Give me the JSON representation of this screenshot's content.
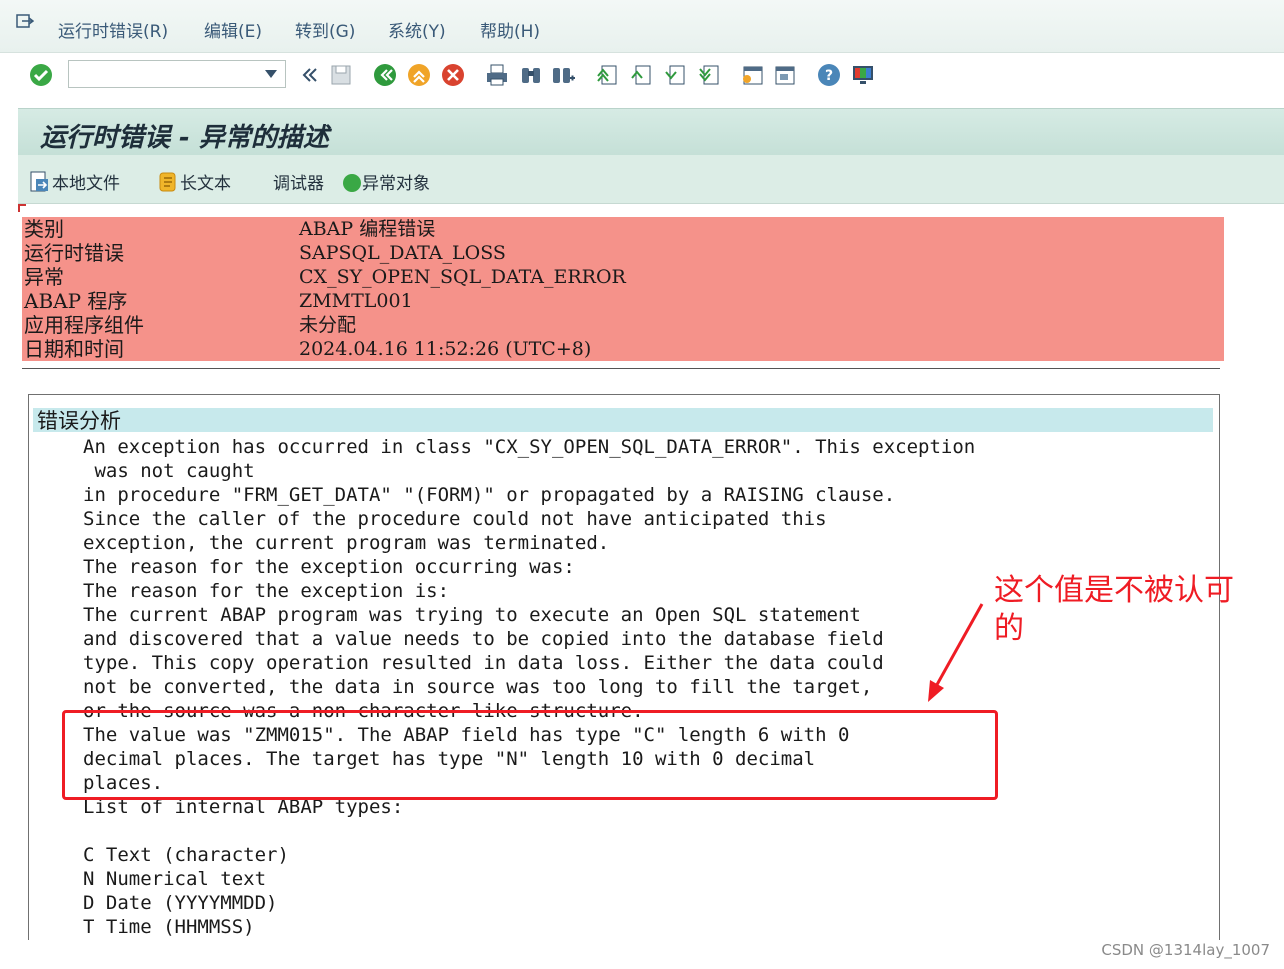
{
  "menu": {
    "items": [
      {
        "label": "运行时错误(R)"
      },
      {
        "label": "编辑(E)"
      },
      {
        "label": "转到(G)"
      },
      {
        "label": "系统(Y)"
      },
      {
        "label": "帮助(H)"
      }
    ]
  },
  "toolbar": {
    "command_field_value": "",
    "icons": [
      "enter-icon",
      "back-arrows-icon",
      "save-icon",
      "back-icon",
      "exit-icon",
      "cancel-icon",
      "print-icon",
      "find-icon",
      "find-next-icon",
      "first-page-icon",
      "previous-page-icon",
      "next-page-icon",
      "last-page-icon",
      "new-session-icon",
      "create-shortcut-icon",
      "help-icon",
      "layout-icon"
    ]
  },
  "title": "运行时错误 - 异常的描述",
  "app_toolbar": {
    "local_file": "本地文件",
    "long_text": "长文本",
    "debugger": "调试器",
    "exception_object": "异常对象"
  },
  "info": [
    {
      "label": "类别",
      "value": "ABAP 编程错误"
    },
    {
      "label": "运行时错误",
      "value": "SAPSQL_DATA_LOSS"
    },
    {
      "label": "异常",
      "value": "CX_SY_OPEN_SQL_DATA_ERROR"
    },
    {
      "label": "ABAP 程序",
      "value": "ZMMTL001"
    },
    {
      "label": "应用程序组件",
      "value": "未分配"
    },
    {
      "label": "日期和时间",
      "value": "2024.04.16 11:52:26 (UTC+8)"
    }
  ],
  "analysis": {
    "title": "错误分析",
    "lines": [
      "An exception has occurred in class \"CX_SY_OPEN_SQL_DATA_ERROR\". This exception",
      " was not caught",
      "in procedure \"FRM_GET_DATA\" \"(FORM)\" or propagated by a RAISING clause.",
      "Since the caller of the procedure could not have anticipated this",
      "exception, the current program was terminated.",
      "The reason for the exception occurring was:",
      "The reason for the exception is:",
      "The current ABAP program was trying to execute an Open SQL statement",
      "and discovered that a value needs to be copied into the database field",
      "type. This copy operation resulted in data loss. Either the data could",
      "not be converted, the data in source was too long to fill the target,",
      "or the source was a non-character-like structure.",
      "The value was \"ZMM015\". The ABAP field has type \"C\" length 6 with 0",
      "decimal places. The target has type \"N\" length 10 with 0 decimal",
      "places.",
      "List of internal ABAP types:",
      "",
      "C Text (character)",
      "N Numerical text",
      "D Date (YYYYMMDD)",
      "T Time (HHMMSS)"
    ]
  },
  "annotation": {
    "text": "这个值是不被认可的",
    "color": "#ef1c24"
  },
  "watermark": "CSDN @1314lay_1007",
  "colors": {
    "info_row_bg": "#f5928a",
    "analysis_header_bg": "#c7e9ec",
    "title_bg": "#c5e0d7"
  }
}
